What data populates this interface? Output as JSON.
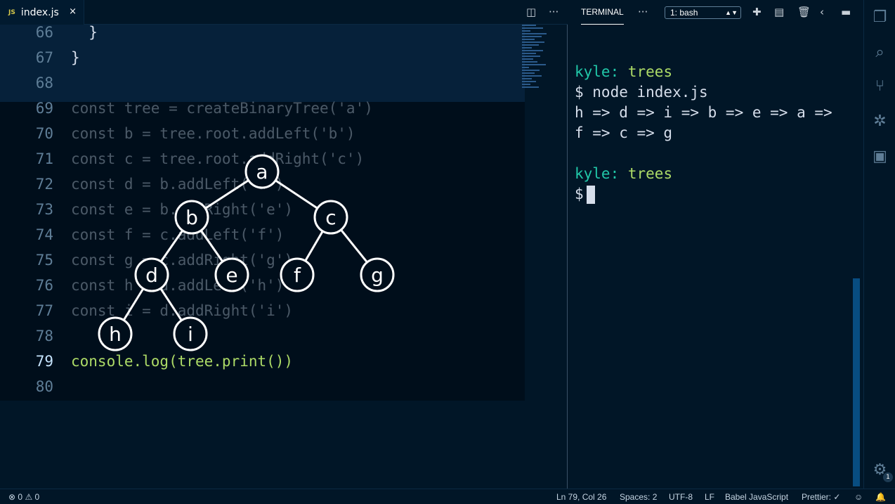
{
  "tab": {
    "badge": "JS",
    "filename": "index.js",
    "close": "×"
  },
  "toolbar_icons": [
    "split-editor-icon",
    "more-actions-icon"
  ],
  "code_lines": [
    {
      "num": "66",
      "text": "  }"
    },
    {
      "num": "67",
      "text": "}"
    },
    {
      "num": "68",
      "text": ""
    },
    {
      "num": "69",
      "text": "const tree = createBinaryTree('a')"
    },
    {
      "num": "70",
      "text": "const b = tree.root.addLeft('b')"
    },
    {
      "num": "71",
      "text": "const c = tree.root.addRight('c')"
    },
    {
      "num": "72",
      "text": "const d = b.addLeft('d')"
    },
    {
      "num": "73",
      "text": "const e = b.addRight('e')"
    },
    {
      "num": "74",
      "text": "const f = c.addLeft('f')"
    },
    {
      "num": "75",
      "text": "const g = c.addRight('g')"
    },
    {
      "num": "76",
      "text": "const h = d.addLeft('h')"
    },
    {
      "num": "77",
      "text": "const i = d.addRight('i')"
    },
    {
      "num": "78",
      "text": ""
    },
    {
      "num": "79",
      "text": "console.log(tree.print())"
    },
    {
      "num": "80",
      "text": ""
    }
  ],
  "tree_nodes": [
    "a",
    "b",
    "c",
    "d",
    "e",
    "f",
    "g",
    "h",
    "i"
  ],
  "terminal": {
    "title": "TERMINAL",
    "more": "···",
    "shell_select": "1: bash",
    "lines": [
      {
        "user": "kyle:",
        "dir": "trees"
      },
      {
        "cmd": "$ node index.js"
      },
      {
        "out": "h => d => i => b => e => a =>"
      },
      {
        "out": "f => c => g"
      },
      {
        "out": ""
      },
      {
        "user": "kyle:",
        "dir": "trees"
      },
      {
        "prompt": "$"
      }
    ]
  },
  "status": {
    "errors": "0",
    "warnings": "0",
    "position": "Ln 79, Col 26",
    "spaces": "Spaces: 2",
    "encoding": "UTF-8",
    "eol": "LF",
    "language": "Babel JavaScript",
    "prettier": "Prettier: ✓",
    "gear_badge": "1"
  }
}
